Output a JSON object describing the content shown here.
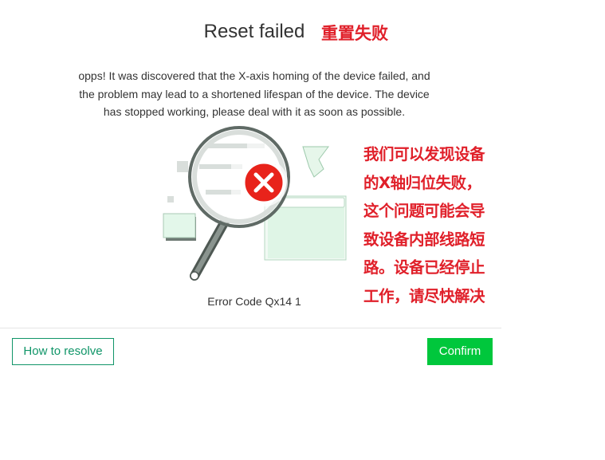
{
  "dialog": {
    "title": "Reset failed",
    "title_annotation": "重置失败",
    "message_lines": [
      "opps! It was discovered that the X-axis homing of the device failed, and",
      "the problem may lead to a shortened lifespan of the device. The device",
      "has stopped working, please deal with it as soon as possible."
    ],
    "error_code": "Error Code Qx14 1",
    "annotation_lines": [
      "我们可以发现设备",
      "的X轴归位失败，",
      "这个问题可能会导",
      "致设备内部线路短",
      "路。设备已经停止",
      "工作，请尽快解决"
    ]
  },
  "footer": {
    "resolve_label": "How to resolve",
    "confirm_label": "Confirm"
  },
  "colors": {
    "accent_green": "#00c73c",
    "outline_green": "#109568",
    "annotation_red": "#e0202a",
    "error_red": "#e8231b"
  },
  "icons": {
    "illustration": "magnifier-error-icon"
  }
}
